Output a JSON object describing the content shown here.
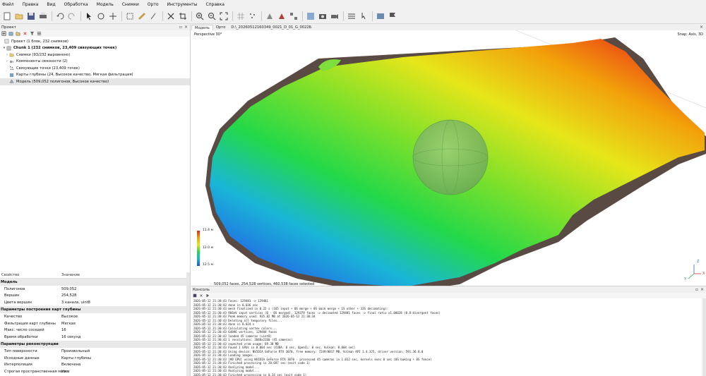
{
  "menu": [
    "Файл",
    "Правка",
    "Вид",
    "Обработка",
    "Модель",
    "Снимки",
    "Орто",
    "Инструменты",
    "Справка"
  ],
  "toolbar_icons": [
    "new-icon",
    "open-icon",
    "save-icon",
    "print-icon",
    "sep",
    "undo-icon",
    "redo-icon",
    "sep",
    "select-cursor-icon",
    "rotate-select-icon",
    "move-icon",
    "sep",
    "region-icon",
    "ruler-icon",
    "draw-icon",
    "sep",
    "close-icon",
    "crop-icon",
    "sep",
    "zoom-in-icon",
    "zoom-out-icon",
    "fit-icon",
    "sep",
    "grid-icon",
    "points-icon",
    "sep",
    "model-solid-icon",
    "shaded-icon",
    "tiled-icon",
    "sep",
    "texture-icon",
    "screenshot-icon",
    "camera-icon",
    "sep",
    "list-icon",
    "pointer-icon",
    "sep",
    "image-icon",
    "flag-icon"
  ],
  "project": {
    "title": "Проект",
    "root": "Проект (1 блок, 232 снимков)",
    "chunk": "Chunk 1 (232 снимков, 23,409 связующих точек)",
    "items": [
      "Снимки (93/232 выровнено)",
      "Компоненты связности (2)",
      "Связующие точки (23,409 точек)",
      "Карты глубины (24, Высокое качество, Мягкая фильтрация)",
      "Модель (509,052 полигонов, Высокое качество)"
    ]
  },
  "properties": {
    "col_property": "Свойство",
    "col_value": "Значение",
    "groups": [
      {
        "title": "Модель",
        "rows": [
          {
            "k": "Полигонов",
            "v": "509,052"
          },
          {
            "k": "Вершин",
            "v": "254,528"
          },
          {
            "k": "Цвета вершин",
            "v": "3 канала, uint8"
          }
        ]
      },
      {
        "title": "Параметры построения карт глубины",
        "rows": [
          {
            "k": "Качество",
            "v": "Высокое"
          },
          {
            "k": "Фильтрация карт глубины",
            "v": "Мягкая"
          },
          {
            "k": "Макс. число соседей",
            "v": "16"
          },
          {
            "k": "Время обработки",
            "v": "16 секунд"
          }
        ]
      },
      {
        "title": "Параметры реконструкции",
        "rows": [
          {
            "k": "Тип поверхности",
            "v": "Произвольный"
          },
          {
            "k": "Исходные данные",
            "v": "Карты глубины"
          },
          {
            "k": "Интерполяция",
            "v": "Включена"
          },
          {
            "k": "Строгая пространственная маска",
            "v": "Нет"
          }
        ]
      }
    ]
  },
  "tabs": [
    "Модель",
    "Орто",
    "D:\\_20260512160349_0021_D_01_G_0022Б"
  ],
  "view": {
    "mode": "Perspective 30°",
    "snap": "Snap: Axis, 3D",
    "status": "509,052 faces, 254,528 vertices, 460,538 faces selected",
    "legend": [
      "11.4 м",
      "12.0 м",
      "12.5 м"
    ],
    "axes": [
      "Z",
      "Y",
      "X"
    ]
  },
  "console": {
    "title": "Консоль",
    "lines": [
      "2026-05-12 21:30:43 Faces: 129481 -> 129481",
      "2026-05-12 21:30:43 done in 0.036 sec",
      "2026-05-12 21:30:43 mesh finalized in 0.22 s (165 input + 0S merge + 0S back merge + 1S other + 32S decimating):",
      "2026-05-12 21:30:43 966eV input vertices (0 - 0S merged), 129379 faces -> decimated 129481 faces -> final ratio x1.00028 (0.8:divergent faces)",
      "2026-05-12 21:30:43 Peak memory used: 935.82 MB at 2026-05-12 21:30:34",
      "2026-05-12 21:30:43 Deleting all temporary files...",
      "2026-05-12 21:30:43 done in 0.024 s",
      "2026-05-12 21:30:43 Calculating vertex colors...",
      "2026-05-12 21:30:43 64896 vertices, 129484 faces",
      "2026-05-12 21:30:43 loaded 45 cameras (uint8)",
      "2026-05-12 21:30:43 1 resolutions: 3840x2160 (45 cameras)",
      "2026-05-12 21:30:43 expected vram usage: 69.38 MB",
      "2026-05-12 21:30:43 Found 1 GPUs in 0.004 sec (CUDA: 0 sec, OpenCL: 0 sec, Vulkan: 0.004 sec)",
      "2026-05-12 21:30:43 Using device: NVIDIA GeForce RTX 3070, free memory: 7249/8017 MB, Vulkan API 1.4.325, driver version: 591.36.0.0",
      "2026-05-12 21:30:43 Loading images...",
      "2026-05-12 21:30:43 [#0 GPU] using NVIDIA GeForce RTX 3070 - processed 45 cameras in 1.012 sec, kernels exec 0 sec (0S baking + 0S fence)",
      "2026-05-12 21:30:43 Finished processing in 20.697 sec (exit code 1)",
      "2026-05-12 21:30:43 Analyzing model...",
      "2026-05-12 21:30:43 Analyzing model...",
      "2026-05-12 21:30:43 Finished processing in 0.24 sec (exit code 1)"
    ]
  },
  "colors": {
    "high": "#e8201a",
    "mid": "#22d84a",
    "low": "#2448e8",
    "selection": "#d8d8d8"
  }
}
